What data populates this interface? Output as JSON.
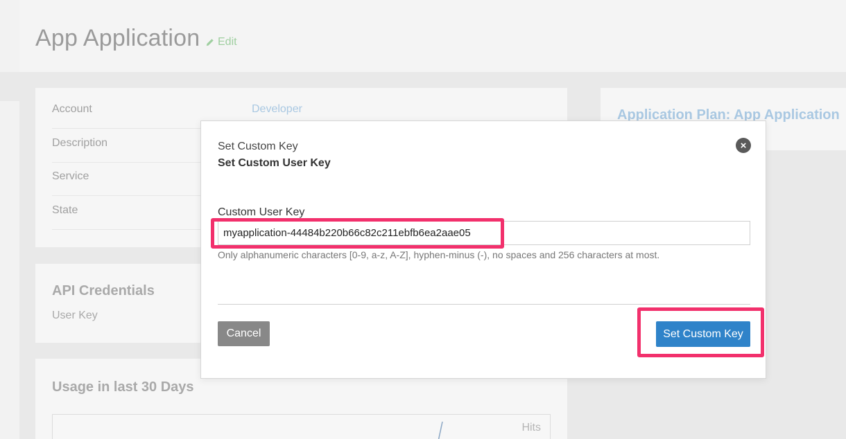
{
  "page": {
    "title": "App Application",
    "edit_label": "Edit"
  },
  "details": [
    {
      "label": "Account",
      "value": "Developer"
    },
    {
      "label": "Description",
      "value": ""
    },
    {
      "label": "Service",
      "value": ""
    },
    {
      "label": "State",
      "value": ""
    }
  ],
  "credentials": {
    "heading": "API Credentials",
    "user_key_label": "User Key"
  },
  "usage": {
    "heading": "Usage in last 30 Days",
    "series_label": "Hits"
  },
  "plan": {
    "link": "Application Plan: App Application"
  },
  "modal": {
    "small_title": "Set Custom Key",
    "title": "Set Custom User Key",
    "field_label": "Custom User Key",
    "field_value": "myapplication-44484b220b66c82c211ebfb6ea2aae05",
    "help": "Only alphanumeric characters [0-9, a-z, A-Z], hyphen-minus (-), no spaces and 256 characters at most.",
    "cancel_label": "Cancel",
    "submit_label": "Set Custom Key",
    "close_symbol": "×"
  },
  "colors": {
    "highlight": "#f2306c",
    "primary_button": "#2f83c9",
    "cancel_button": "#888888"
  }
}
